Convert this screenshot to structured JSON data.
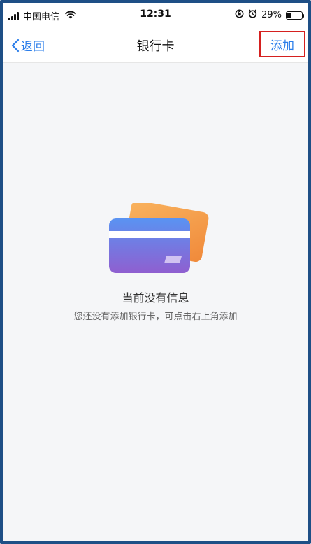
{
  "status_bar": {
    "carrier": "中国电信",
    "time": "12:31",
    "battery_percent": "29%",
    "battery_level": 0.29,
    "icons": [
      "signal-icon",
      "wifi-icon",
      "screen-rotation-lock-icon",
      "alarm-icon",
      "battery-icon"
    ]
  },
  "nav": {
    "back_label": "返回",
    "title": "银行卡",
    "add_label": "添加"
  },
  "empty_state": {
    "title": "当前没有信息",
    "description": "您还没有添加银行卡，可点击右上角添加",
    "illustration": "bank-card-icon"
  },
  "colors": {
    "accent": "#2a7dea",
    "highlight_border": "#d5201f",
    "card_front_top": "#5b8ef0",
    "card_front_bottom": "#8a63d2",
    "card_back": "#f5a04a",
    "background": "#f5f6f8"
  }
}
